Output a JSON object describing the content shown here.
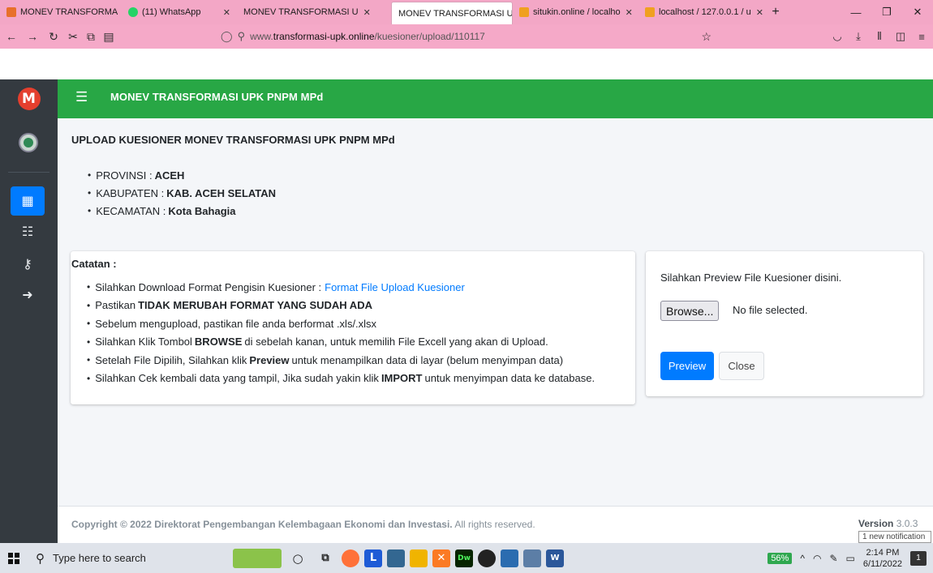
{
  "browser": {
    "tabs": [
      {
        "label": "MONEV TRANSFORMA",
        "favicon_color": "#e8702a",
        "active": false
      },
      {
        "label": "(11) WhatsApp",
        "favicon_color": "#25d366",
        "active": false
      },
      {
        "label": "MONEV TRANSFORMASI U",
        "favicon_color": "",
        "active": false
      },
      {
        "label": "MONEV TRANSFORMASI U",
        "favicon_color": "",
        "active": true
      },
      {
        "label": "situkin.online / localho",
        "favicon_color": "#f0a020",
        "active": false
      },
      {
        "label": "localhost / 127.0.0.1 / u",
        "favicon_color": "#f0a020",
        "active": false
      }
    ],
    "url_prefix": "www.",
    "url_host": "transformasi-upk.online",
    "url_path": "/kuesioner/upload/110117"
  },
  "app": {
    "title": "MONEV TRANSFORMASI UPK PNPM MPd",
    "logo_letter": "M"
  },
  "page": {
    "heading": "UPLOAD KUESIONER MONEV TRANSFORMASI UPK PNPM MPd",
    "location": [
      {
        "label": "PROVINSI :",
        "value": "ACEH"
      },
      {
        "label": "KABUPATEN :",
        "value": "KAB. ACEH SELATAN"
      },
      {
        "label": "KECAMATAN :",
        "value": "Kota Bahagia"
      }
    ],
    "notes_title": "Catatan :",
    "notes": {
      "n1_text": "Silahkan Download Format Pengisin Kuesioner :",
      "n1_link": "Format File Upload Kuesioner",
      "n2_text": "Pastikan",
      "n2_bold": "TIDAK MERUBAH FORMAT YANG SUDAH ADA",
      "n3_text": "Sebelum mengupload, pastikan file anda berformat .xls/.xlsx",
      "n4_pre": "Silahkan Klik Tombol",
      "n4_bold": "BROWSE",
      "n4_post": "di sebelah kanan, untuk memilih File Excell yang akan di Upload.",
      "n5_pre": "Setelah File Dipilih, Silahkan klik",
      "n5_bold": "Preview",
      "n5_post": "untuk menampilkan data di layar (belum menyimpan data)",
      "n6_pre": "Silahkan Cek kembali data yang tampil, Jika sudah yakin klik",
      "n6_bold": "IMPORT",
      "n6_post": "untuk menyimpan data ke database."
    },
    "preview_label": "Silahkan Preview File Kuesioner disini.",
    "browse_label": "Browse...",
    "no_file": "No file selected.",
    "preview_button": "Preview",
    "close_button": "Close"
  },
  "footer": {
    "copyright_bold": "Copyright © 2022 Direktorat Pengembangan Kelembagaan Ekonomi dan Investasi.",
    "copyright_rest": "All rights reserved.",
    "version_label": "Version",
    "version_value": "3.0.3",
    "notification": "1 new notification"
  },
  "taskbar": {
    "search_placeholder": "Type here to search",
    "battery": "56%",
    "time": "2:14 PM",
    "date": "6/11/2022",
    "action_count": "1"
  },
  "colors": {
    "header_green": "#28a745",
    "sidebar_dark": "#343a40",
    "primary_blue": "#007bff",
    "browser_pink": "#f3a7c6"
  }
}
